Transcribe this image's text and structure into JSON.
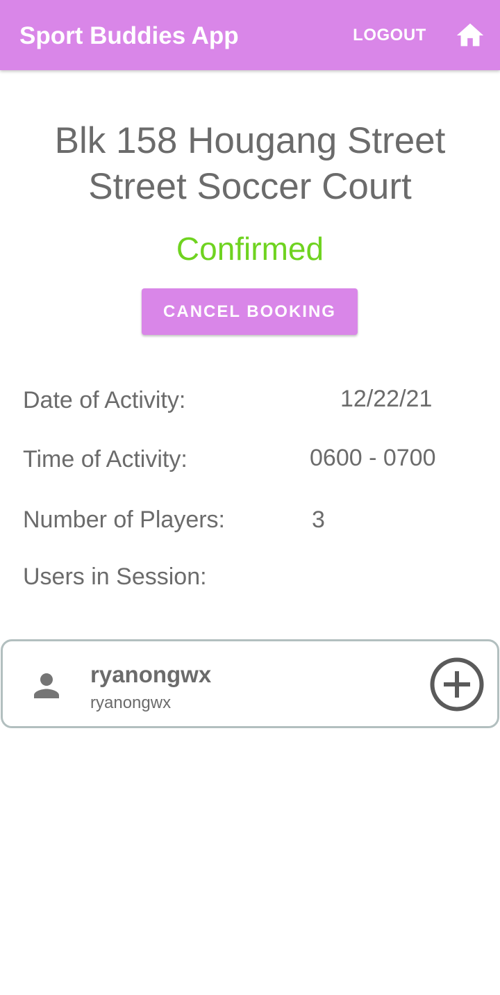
{
  "app_bar": {
    "title": "Sport Buddies App",
    "logout_label": "LOGOUT",
    "home_icon": "home-icon",
    "background_color": "#d986e8"
  },
  "booking": {
    "venue_name": "Blk 158 Hougang Street Street Soccer Court",
    "status": "Confirmed",
    "status_color": "#6fd320",
    "cancel_label": "CANCEL BOOKING"
  },
  "details": {
    "date_label": "Date of Activity:",
    "date_value": "12/22/21",
    "time_label": "Time of Activity:",
    "time_value": "0600 - 0700",
    "players_label": "Number of Players:",
    "players_value": "3",
    "users_label": "Users in Session:"
  },
  "users": [
    {
      "name": "ryanongwx",
      "username": "ryanongwx",
      "avatar_icon": "person-icon",
      "action_icon": "add-circle-icon"
    }
  ]
}
